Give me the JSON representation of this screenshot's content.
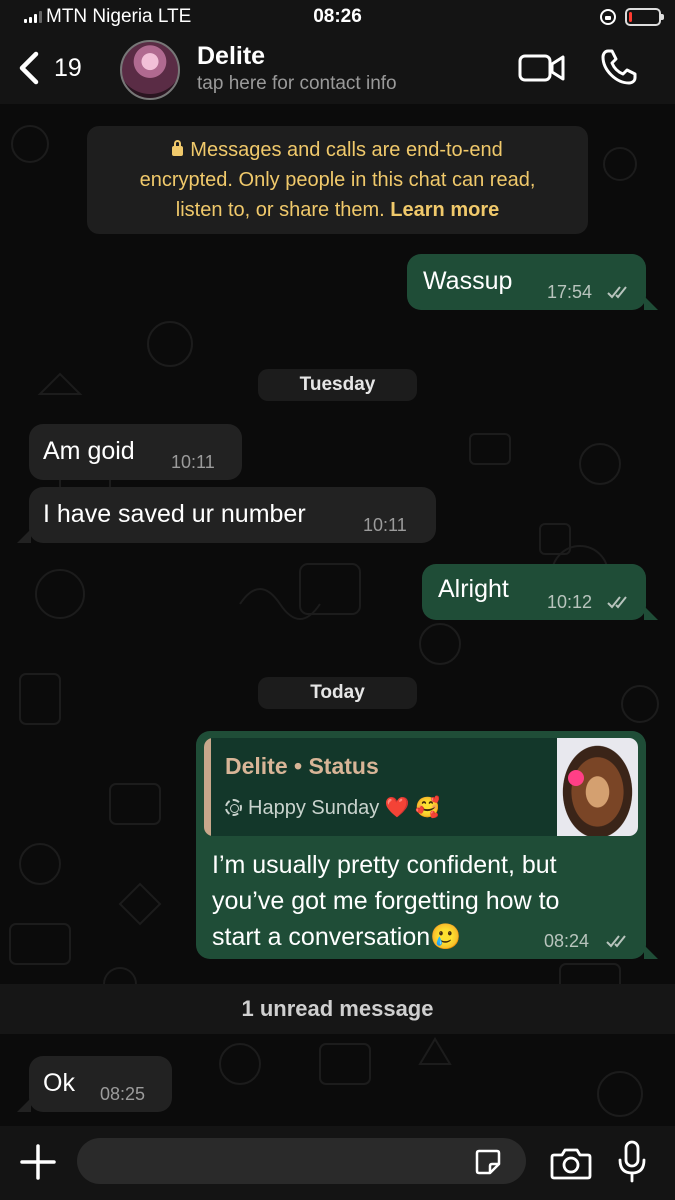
{
  "status_bar": {
    "carrier": "MTN Nigeria  LTE",
    "time": "08:26",
    "battery_level": 0.1,
    "battery_color": "#ff3b30"
  },
  "header": {
    "back_count": "19",
    "contact_name": "Delite",
    "contact_subtitle": "tap here for contact info",
    "icons": [
      "back-chevron-icon",
      "video-call-icon",
      "voice-call-icon"
    ]
  },
  "chat": {
    "encryption_notice": {
      "text": "Messages and calls are end-to-end encrypted. Only people in this chat can read, listen to, or share them.",
      "link": "Learn more"
    },
    "messages": [
      {
        "direction": "out",
        "text": "Wassup",
        "time": "17:54",
        "status": "read"
      },
      {
        "type": "date",
        "label": "Tuesday"
      },
      {
        "direction": "in",
        "text": "Am goid",
        "time": "10:11"
      },
      {
        "direction": "in",
        "text": "I have saved ur number",
        "time": "10:11"
      },
      {
        "direction": "out",
        "text": "Alright",
        "time": "10:12",
        "status": "read"
      },
      {
        "type": "date",
        "label": "Today"
      },
      {
        "direction": "out",
        "reply_to": {
          "title": "Delite • Status",
          "text": "Happy Sunday ❤️ 🥰"
        },
        "lines": [
          "I’m usually pretty confident, but",
          "you’ve got me forgetting how to",
          "start a conversation🥲"
        ],
        "time": "08:24",
        "status": "read"
      },
      {
        "type": "unread_divider",
        "label": "1 unread message"
      },
      {
        "direction": "in",
        "text": "Ok",
        "time": "08:25"
      }
    ]
  },
  "input_bar": {
    "message_value": "",
    "icons": [
      "plus-icon",
      "sticker-icon",
      "camera-icon",
      "microphone-icon"
    ]
  },
  "colors": {
    "outgoing_bubble": "#1f4d37",
    "incoming_bubble": "#222222",
    "encryption_text": "#f0c96b",
    "background": "#0b0b0b"
  }
}
